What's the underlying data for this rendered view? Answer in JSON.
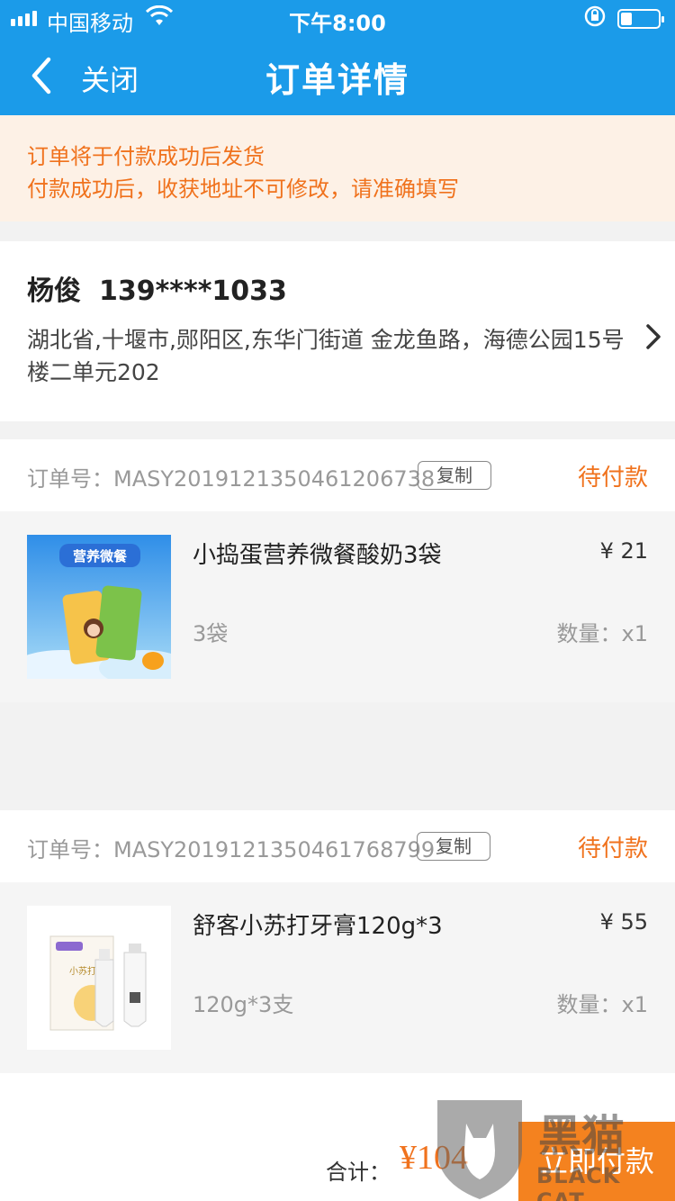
{
  "status_bar": {
    "carrier": "中国移动",
    "time": "下午8:00"
  },
  "nav": {
    "close_label": "关闭",
    "title": "订单详情"
  },
  "notice": {
    "line1": "订单将于付款成功后发货",
    "line2": "付款成功后，收获地址不可修改，请准确填写"
  },
  "address": {
    "name": "杨俊",
    "phone": "139****1033",
    "detail": "湖北省,十堰市,郧阳区,东华门街道 金龙鱼路，海德公园15号楼二单元202"
  },
  "orders": [
    {
      "order_no_label": "订单号：",
      "order_no": "MASY2019121350461206738",
      "copy_label": "复制",
      "status": "待付款",
      "product_name": "小捣蛋营养微餐酸奶3袋",
      "price": "¥ 21",
      "spec": "3袋",
      "quantity": "数量：x1",
      "thumb_text": "营养微餐"
    },
    {
      "order_no_label": "订单号：",
      "order_no": "MASY2019121350461768799",
      "copy_label": "复制",
      "status": "待付款",
      "product_name": "舒客小苏打牙膏120g*3",
      "price": "¥ 55",
      "spec": "120g*3支",
      "quantity": "数量：x1",
      "thumb_text": "小苏打"
    }
  ],
  "footer": {
    "total_label": "合计：",
    "total_value": "¥104",
    "pay_label": "立即付款"
  },
  "watermark": {
    "cn": "黑猫",
    "en": "BLACK CAT"
  },
  "colors": {
    "header_blue": "#1b9be9",
    "accent_orange": "#f0721d",
    "notice_bg": "#fdf1e6"
  }
}
